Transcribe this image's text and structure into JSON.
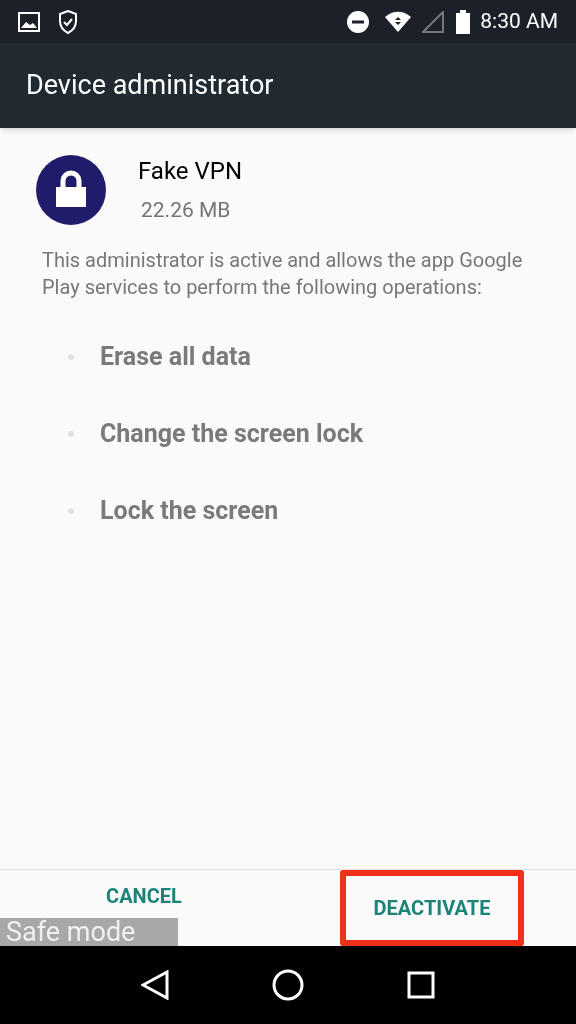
{
  "status_bar": {
    "time": "8:30 AM"
  },
  "app_bar": {
    "title": "Device administrator"
  },
  "app": {
    "name": "Fake VPN",
    "size": "22.26 MB"
  },
  "description": "This administrator is active and allows the app Google Play services to perform the following operations:",
  "permissions": [
    "Erase all data",
    "Change the screen lock",
    "Lock the screen"
  ],
  "buttons": [
    {
      "label": "CANCEL",
      "highlighted": false
    },
    {
      "label": "DEACTIVATE",
      "highlighted": true
    }
  ],
  "overlay": {
    "text": "Safe mode"
  }
}
